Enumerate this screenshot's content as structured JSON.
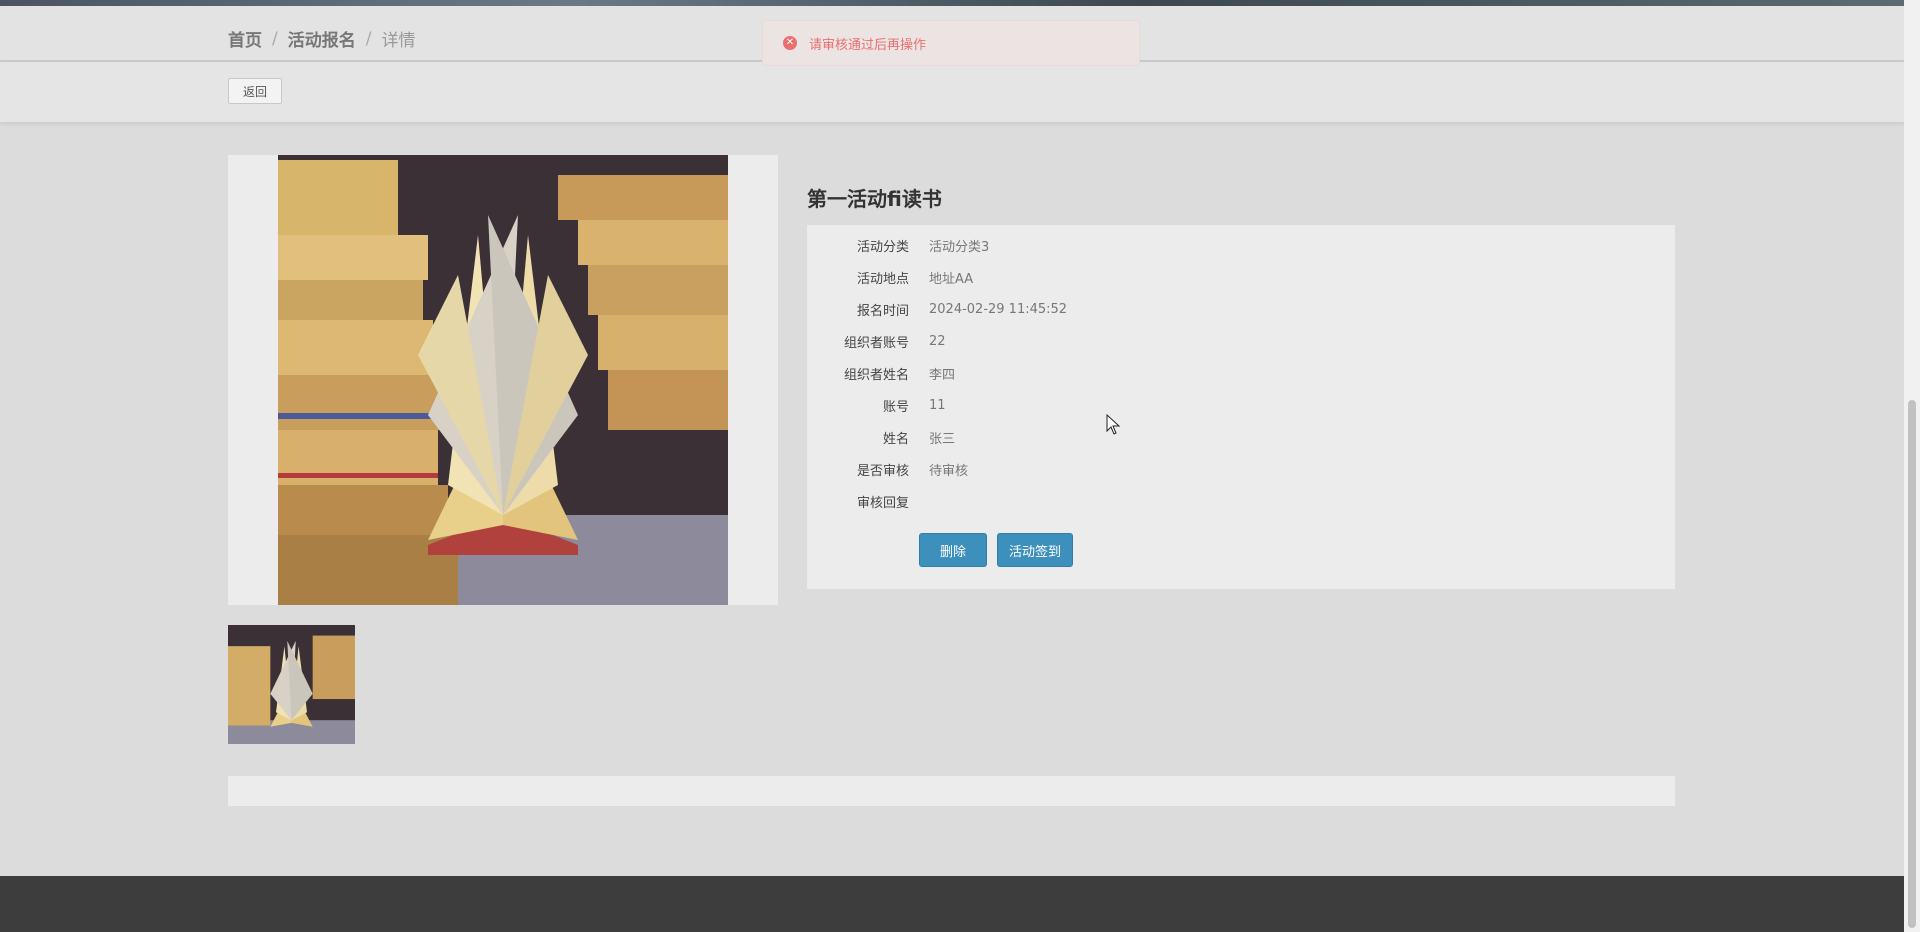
{
  "breadcrumb": {
    "home": "首页",
    "section": "活动报名",
    "current": "详情",
    "separator": "/"
  },
  "actions": {
    "back_label": "返回"
  },
  "toast": {
    "message": "请审核通过后再操作",
    "icon": "error-circle-icon",
    "color": "#e9706f"
  },
  "detail": {
    "title": "第一活动fi读书",
    "fields": [
      {
        "label": "活动分类",
        "value": "活动分类3"
      },
      {
        "label": "活动地点",
        "value": "地址AA"
      },
      {
        "label": "报名时间",
        "value": "2024-02-29 11:45:52"
      },
      {
        "label": "组织者账号",
        "value": "22"
      },
      {
        "label": "组织者姓名",
        "value": "李四"
      },
      {
        "label": "账号",
        "value": "11"
      },
      {
        "label": "姓名",
        "value": "张三"
      },
      {
        "label": "是否审核",
        "value": "待审核"
      },
      {
        "label": "审核回复",
        "value": ""
      }
    ],
    "delete_label": "删除",
    "signin_label": "活动签到"
  },
  "colors": {
    "primary_button": "#3d8fbc",
    "footer": "#3d3d3d"
  }
}
